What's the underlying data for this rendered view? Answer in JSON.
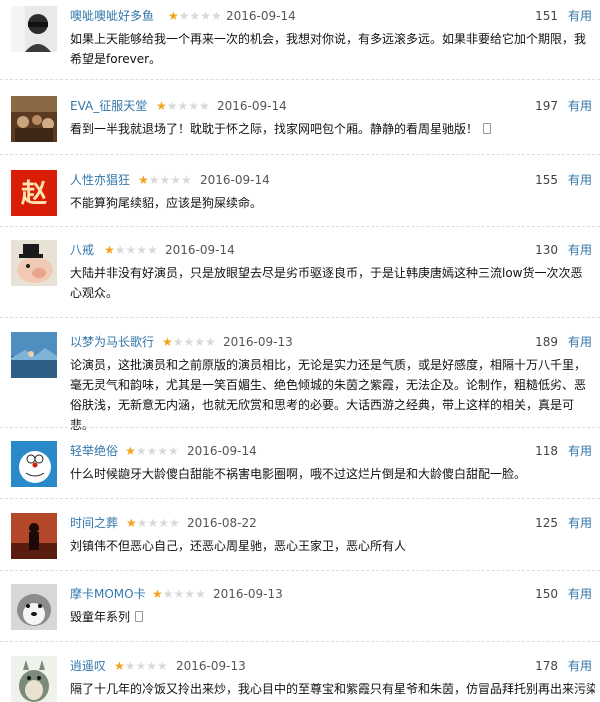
{
  "colors": {
    "link": "#3377aa",
    "star": "#f2a31b",
    "star_off": "#d9d9d9"
  },
  "reviews": [
    {
      "user": "噢呲噢呲好多鱼",
      "rating": 1,
      "date": "2016-09-14",
      "votes": "151",
      "useful": "有用",
      "text": "如果上天能够给我一个再来一次的机会，我想对你说，有多远滚多远。如果非要给它加个期限，我希望是forever。",
      "mobile": false,
      "avatar": "avatar-partial-douban-icon"
    },
    {
      "user": "EVA_征服天堂",
      "rating": 1,
      "date": "2016-09-14",
      "votes": "197",
      "useful": "有用",
      "text": "看到一半我就退场了！耽耽于怀之际，找家网吧包个厢。静静的看周星驰版！",
      "mobile": true,
      "avatar": "painting-avatar-icon"
    },
    {
      "user": "人性亦猖狂",
      "rating": 1,
      "date": "2016-09-14",
      "votes": "155",
      "useful": "有用",
      "text": "不能算狗尾续貂，应该是狗屎续命。",
      "mobile": false,
      "avatar": "zhao-character-avatar-icon",
      "avatar_char": "赵"
    },
    {
      "user": "八戒",
      "rating": 1,
      "date": "2016-09-14",
      "votes": "130",
      "useful": "有用",
      "text": "大陆并非没有好演员，只是放眼望去尽是劣币驱逐良币，于是让韩庚唐嫣这种三流low货一次次恶心观众。",
      "mobile": false,
      "avatar": "pig-avatar-icon"
    },
    {
      "user": "以梦为马长歌行",
      "rating": 1,
      "date": "2016-09-13",
      "votes": "189",
      "useful": "有用",
      "text": "论演员，这批演员和之前原版的演员相比，无论是实力还是气质，或是好感度，相隔十万八千里，毫无灵气和韵味，尤其是一笑百媚生、绝色倾城的朱茵之紫霞，无法企及。论制作，粗糙低劣、恶俗肤浅，无新意无内涵，也就无欣赏和思考的必要。大话西游之经典，带上这样的相关，真是可悲。",
      "mobile": false,
      "avatar": "landscape-avatar-icon"
    },
    {
      "user": "轻举绝俗",
      "rating": 1,
      "date": "2016-09-14",
      "votes": "118",
      "useful": "有用",
      "text": "什么时候龅牙大龄傻白甜能不祸害电影圈啊，哦不过这烂片倒是和大龄傻白甜配一脸。",
      "mobile": false,
      "avatar": "doraemon-avatar-icon"
    },
    {
      "user": "时间之葬",
      "rating": 1,
      "date": "2016-08-22",
      "votes": "125",
      "useful": "有用",
      "text": "刘镇伟不但恶心自己，还恶心周星驰，恶心王家卫，恶心所有人",
      "mobile": false,
      "avatar": "figure-avatar-icon"
    },
    {
      "user": "摩卡MOMO卡",
      "rating": 1,
      "date": "2016-09-13",
      "votes": "150",
      "useful": "有用",
      "text": "毁童年系列",
      "mobile": true,
      "avatar": "husky-avatar-icon"
    },
    {
      "user": "逍遥叹",
      "rating": 1,
      "date": "2016-09-13",
      "votes": "178",
      "useful": "有用",
      "text": "隔了十几年的冷饭又拎出来炒，我心目中的至尊宝和紫霞只有星爷和朱茵，仿冒品拜托别再出来污染",
      "mobile": false,
      "avatar": "totoro-avatar-icon"
    }
  ]
}
